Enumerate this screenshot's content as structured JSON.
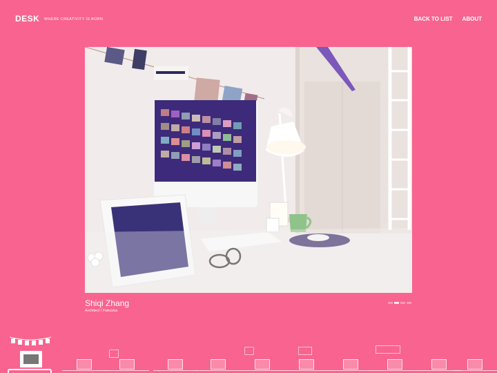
{
  "header": {
    "logo": "DESK",
    "tagline": "WHERE CREATIVITY IS BORN",
    "nav": [
      {
        "label": "BACK TO LIST"
      },
      {
        "label": "ABOUT"
      }
    ]
  },
  "feature": {
    "image_alt_icon": "desk-photo",
    "name": "Shiqi Zhang",
    "role": "Architect / Fukuoka",
    "pager_active": 2
  },
  "colors": {
    "background": "#f8648f",
    "text": "#ffffff"
  },
  "thumbnails": [
    {
      "name": "desk-thumb-1",
      "active": true
    },
    {
      "name": "desk-thumb-2",
      "active": false
    },
    {
      "name": "desk-thumb-3",
      "active": false
    },
    {
      "name": "desk-thumb-4",
      "active": false
    },
    {
      "name": "desk-thumb-5",
      "active": false
    },
    {
      "name": "desk-thumb-6",
      "active": false
    },
    {
      "name": "desk-thumb-7",
      "active": false
    },
    {
      "name": "desk-thumb-8",
      "active": false
    },
    {
      "name": "desk-thumb-9",
      "active": false
    },
    {
      "name": "desk-thumb-10",
      "active": false
    },
    {
      "name": "desk-thumb-11",
      "active": false
    }
  ]
}
